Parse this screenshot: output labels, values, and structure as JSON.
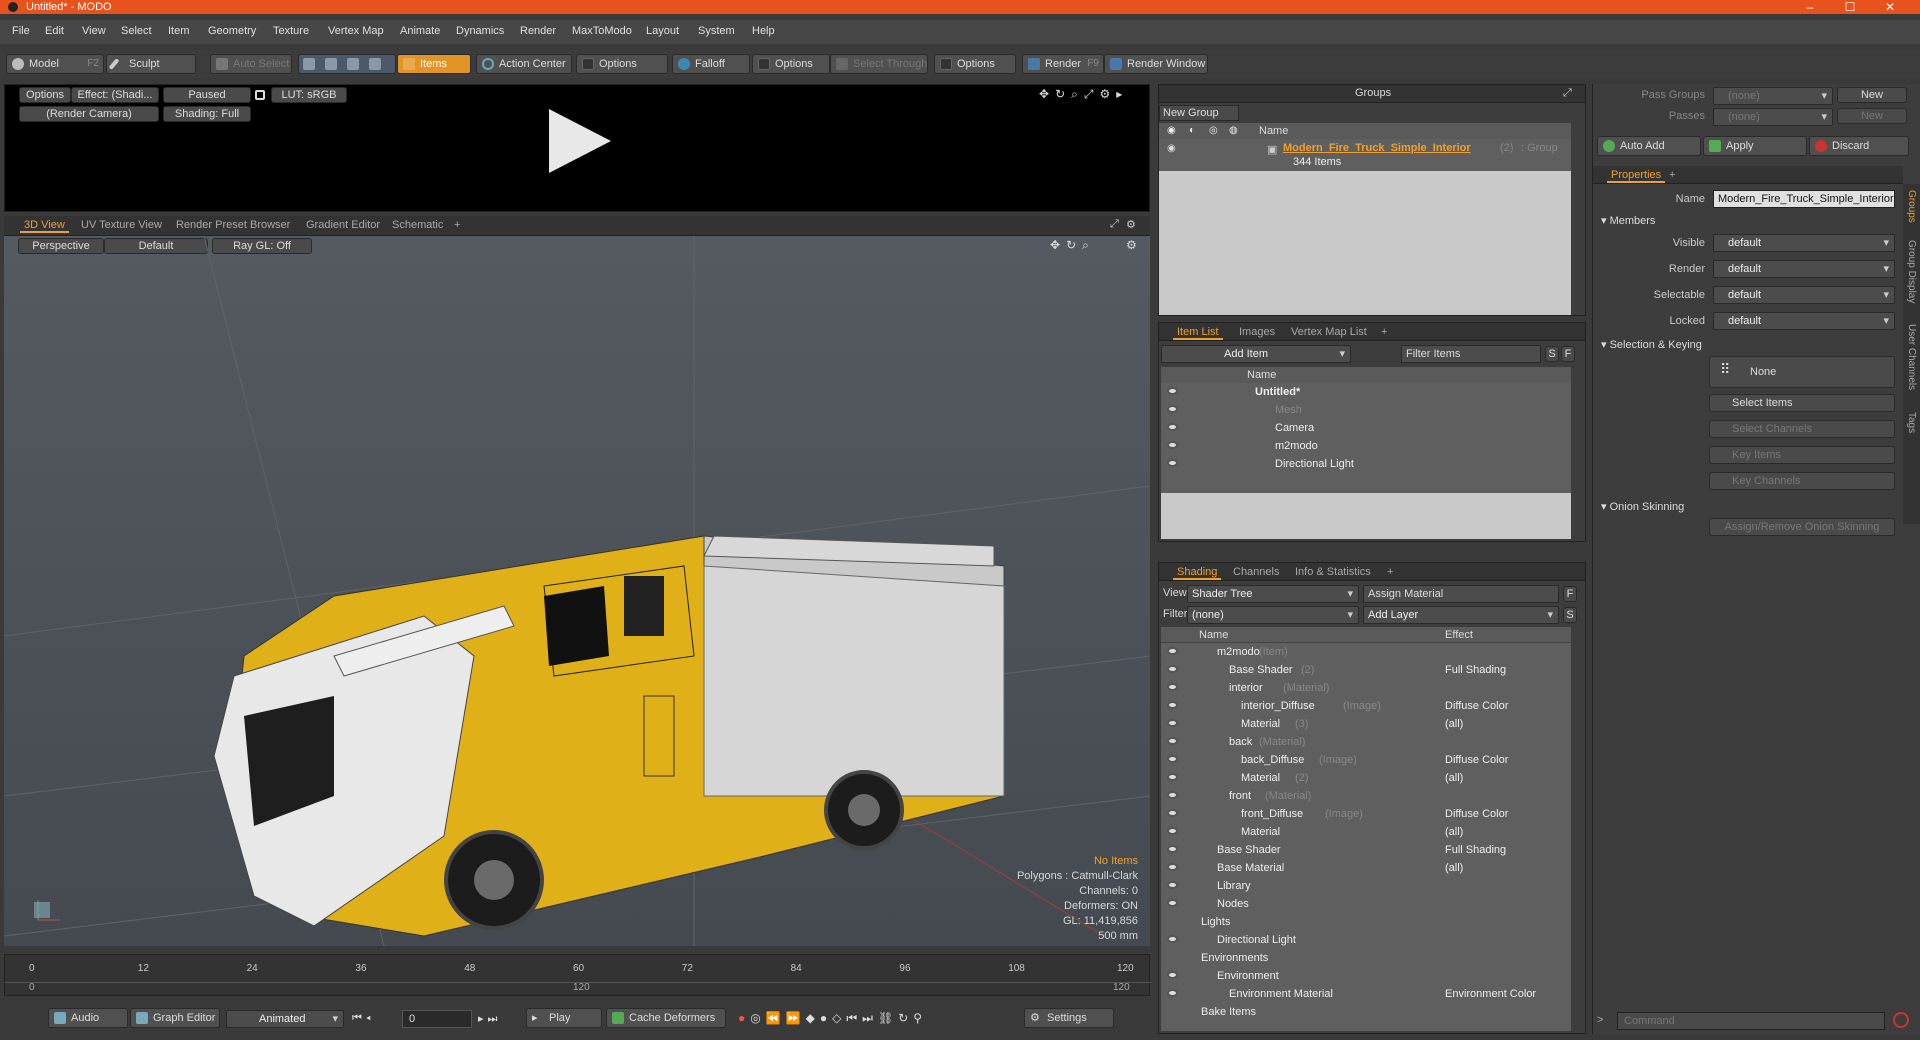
{
  "window": {
    "title": "Untitled* - MODO",
    "minimize": "–",
    "maximize": "☐",
    "close": "✕"
  },
  "menu": [
    "File",
    "Edit",
    "View",
    "Select",
    "Item",
    "Geometry",
    "Texture",
    "Vertex Map",
    "Animate",
    "Dynamics",
    "Render",
    "MaxToModo",
    "Layout",
    "System",
    "Help"
  ],
  "toolbar": {
    "model": "Model",
    "model_key": "F2",
    "sculpt": "Sculpt",
    "auto_select": "Auto Select",
    "items": "Items",
    "action_center": "Action Center",
    "options1": "Options",
    "falloff": "Falloff",
    "options2": "Options",
    "select_through": "Select Through",
    "options3": "Options",
    "render": "Render",
    "render_key": "F9",
    "render_window": "Render Window"
  },
  "preview": {
    "options": "Options",
    "effect": "Effect: (Shadi...",
    "paused": "Paused",
    "lut": "LUT: sRGB",
    "camera": "(Render Camera)",
    "shading": "Shading: Full"
  },
  "viewport": {
    "tabs": [
      "3D View",
      "UV Texture View",
      "Render Preset Browser",
      "Gradient Editor",
      "Schematic",
      "+"
    ],
    "perspective": "Perspective",
    "default": "Default",
    "raygl": "Ray GL: Off",
    "stats": [
      "No Items",
      "Polygons : Catmull-Clark",
      "Channels: 0",
      "Deformers: ON",
      "GL: 11,419,856",
      "500 mm"
    ]
  },
  "timeline": {
    "ticks": [
      "0",
      "12",
      "24",
      "36",
      "48",
      "60",
      "72",
      "84",
      "96",
      "108",
      "120"
    ],
    "sub_left": "0",
    "sub_mid": "120",
    "sub_right": "120"
  },
  "bottombar": {
    "audio": "Audio",
    "graph_editor": "Graph Editor",
    "animated": "Animated",
    "frame": "0",
    "play": "Play",
    "cache_deformers": "Cache Deformers",
    "settings": "Settings"
  },
  "groups": {
    "title": "Groups",
    "new_group": "New Group",
    "col_name": "Name",
    "item_name": "Modern_Fire_Truck_Simple_Interior",
    "item_count": "(2)",
    "item_type": ": Group",
    "item_sub": "344 Items"
  },
  "itemlist": {
    "tabs": [
      "Item List",
      "Images",
      "Vertex Map List",
      "+"
    ],
    "add_item": "Add Item",
    "filter": "Filter Items",
    "s": "S",
    "f": "F",
    "col_name": "Name",
    "rows": [
      {
        "label": "Untitled*",
        "indent": 0,
        "dim": false,
        "bold": true
      },
      {
        "label": "Mesh",
        "indent": 1,
        "dim": true,
        "bold": false
      },
      {
        "label": "Camera",
        "indent": 1,
        "dim": false,
        "bold": false
      },
      {
        "label": "m2modo",
        "indent": 1,
        "dim": false,
        "bold": false
      },
      {
        "label": "Directional Light",
        "indent": 1,
        "dim": false,
        "bold": false
      }
    ]
  },
  "shading": {
    "tabs": [
      "Shading",
      "Channels",
      "Info & Statistics",
      "+"
    ],
    "view_label": "View",
    "view_value": "Shader Tree",
    "assign_material": "Assign Material",
    "f": "F",
    "filter_label": "Filter",
    "filter_value": "(none)",
    "add_layer": "Add Layer",
    "s": "S",
    "col_name": "Name",
    "col_effect": "Effect",
    "rows": [
      {
        "name": "m2modo",
        "type": "(Item)",
        "effect": "",
        "indent": 0
      },
      {
        "name": "Base Shader",
        "type": "(2)",
        "effect": "Full Shading",
        "indent": 1
      },
      {
        "name": "interior",
        "type": "(Material)",
        "effect": "",
        "indent": 1
      },
      {
        "name": "interior_Diffuse",
        "type": "(Image)",
        "effect": "Diffuse Color",
        "indent": 2
      },
      {
        "name": "Material",
        "type": "(3)",
        "effect": "(all)",
        "indent": 2
      },
      {
        "name": "back",
        "type": "(Material)",
        "effect": "",
        "indent": 1
      },
      {
        "name": "back_Diffuse",
        "type": "(Image)",
        "effect": "Diffuse Color",
        "indent": 2
      },
      {
        "name": "Material",
        "type": "(2)",
        "effect": "(all)",
        "indent": 2
      },
      {
        "name": "front",
        "type": "(Material)",
        "effect": "",
        "indent": 1
      },
      {
        "name": "front_Diffuse",
        "type": "(Image)",
        "effect": "Diffuse Color",
        "indent": 2
      },
      {
        "name": "Material",
        "type": "",
        "effect": "(all)",
        "indent": 2
      },
      {
        "name": "Base Shader",
        "type": "",
        "effect": "Full Shading",
        "indent": 0
      },
      {
        "name": "Base Material",
        "type": "",
        "effect": "(all)",
        "indent": 0
      },
      {
        "name": "Library",
        "type": "",
        "effect": "",
        "indent": 0
      },
      {
        "name": "Nodes",
        "type": "",
        "effect": "",
        "indent": 0
      },
      {
        "name": "Lights",
        "type": "",
        "effect": "",
        "indent": -1
      },
      {
        "name": "Directional Light",
        "type": "",
        "effect": "",
        "indent": 0
      },
      {
        "name": "Environments",
        "type": "",
        "effect": "",
        "indent": -1
      },
      {
        "name": "Environment",
        "type": "",
        "effect": "",
        "indent": 0
      },
      {
        "name": "Environment Material",
        "type": "",
        "effect": "Environment Color",
        "indent": 1
      },
      {
        "name": "Bake Items",
        "type": "",
        "effect": "",
        "indent": -1
      }
    ]
  },
  "props": {
    "pass_groups": "Pass Groups",
    "pass_groups_val": "(none)",
    "new1": "New",
    "passes": "Passes",
    "passes_val": "(none)",
    "new2": "New",
    "auto_add": "Auto Add",
    "apply": "Apply",
    "discard": "Discard",
    "tab": "Properties",
    "plus": "+",
    "name_label": "Name",
    "name_val": "Modern_Fire_Truck_Simple_Interior",
    "members": "Members",
    "visible": "Visible",
    "visible_val": "default",
    "render": "Render",
    "render_val": "default",
    "selectable": "Selectable",
    "selectable_val": "default",
    "locked": "Locked",
    "locked_val": "default",
    "sel_keying": "Selection & Keying",
    "none": "None",
    "select_items": "Select Items",
    "select_channels": "Select Channels",
    "key_items": "Key Items",
    "key_channels": "Key Channels",
    "onion": "Onion Skinning",
    "assign_onion": "Assign/Remove Onion Skinning",
    "side_tabs": [
      "Groups",
      "Group Display",
      "User Channels",
      "Tags"
    ],
    "command_placeholder": "Command"
  }
}
